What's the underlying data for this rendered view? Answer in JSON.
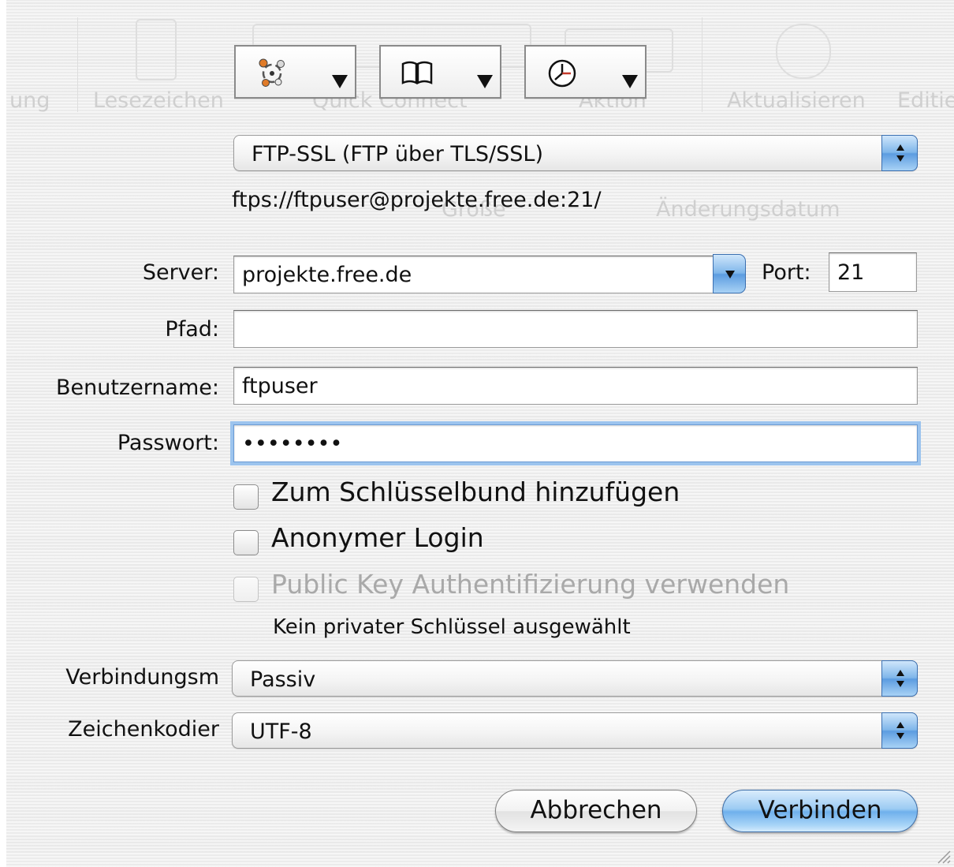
{
  "background_toolbar": {
    "ghost_labels": [
      "ung",
      "Lesezeichen",
      "Quick Connect",
      "Aktion",
      "Aktualisieren",
      "Editie"
    ],
    "ghost_columns": [
      "Größe",
      "Änderungsdatum"
    ]
  },
  "toolbar": {
    "buttons": [
      {
        "name": "transfer",
        "icon": "network-icon"
      },
      {
        "name": "bookmarks",
        "icon": "book-icon"
      },
      {
        "name": "history",
        "icon": "clock-icon"
      }
    ]
  },
  "protocol": {
    "selected": "FTP-SSL (FTP über TLS/SSL)"
  },
  "url": "ftps://ftpuser@projekte.free.de:21/",
  "form": {
    "server_label": "Server:",
    "server_value": "projekte.free.de",
    "port_label": "Port:",
    "port_value": "21",
    "path_label": "Pfad:",
    "path_value": "",
    "username_label": "Benutzername:",
    "username_value": "ftpuser",
    "password_label": "Passwort:",
    "password_value": "••••••••"
  },
  "options": {
    "keychain_label": "Zum Schlüsselbund hinzufügen",
    "keychain_checked": false,
    "anonymous_label": "Anonymer Login",
    "anonymous_checked": false,
    "pubkey_label": "Public Key Authentifizierung verwenden",
    "pubkey_checked": false,
    "pubkey_enabled": false,
    "pubkey_note": "Kein privater Schlüssel ausgewählt"
  },
  "connection_mode": {
    "label": "Verbindungsm",
    "selected": "Passiv"
  },
  "encoding": {
    "label": "Zeichenkodier",
    "selected": "UTF-8"
  },
  "buttons": {
    "cancel": "Abbrechen",
    "connect": "Verbinden"
  },
  "colors": {
    "accent_blue": "#7fb6ea",
    "focus_ring": "#9cc4ee",
    "disabled_text": "#a9a9a9"
  }
}
